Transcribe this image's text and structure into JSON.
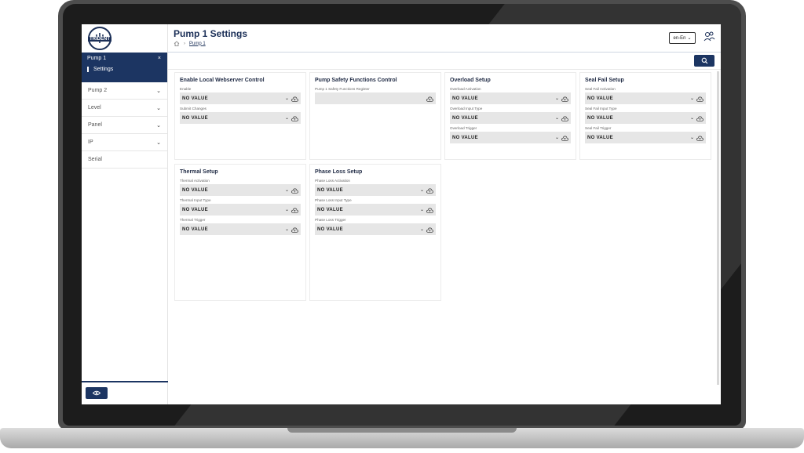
{
  "app": {
    "logo_text": "TRIDENT",
    "page_title": "Pump 1 Settings",
    "breadcrumb": {
      "home_icon": "home-icon",
      "current": "Pump 1"
    },
    "language": "en-En"
  },
  "sidebar": {
    "active": {
      "label": "Pump 1",
      "close": "×",
      "sub_label": "Settings"
    },
    "items": [
      {
        "label": "Pump 2",
        "has_chevron": true
      },
      {
        "label": "Level",
        "has_chevron": true
      },
      {
        "label": "Panel",
        "has_chevron": true
      },
      {
        "label": "IP",
        "has_chevron": true
      },
      {
        "label": "Serial",
        "has_chevron": false
      }
    ]
  },
  "cards": [
    {
      "title": "Enable Local Webserver Control",
      "fields": [
        {
          "label": "Enable",
          "value": "NO VALUE"
        },
        {
          "label": "Submit Changes",
          "value": "NO VALUE"
        }
      ]
    },
    {
      "title": "Pump Safety Functions Control",
      "fields": [
        {
          "label": "Pump 1 Safety Functions Register",
          "value": ""
        }
      ]
    },
    {
      "title": "Overload Setup",
      "fields": [
        {
          "label": "Overload Activation",
          "value": "NO VALUE"
        },
        {
          "label": "Overload Input Type",
          "value": "NO VALUE"
        },
        {
          "label": "Overload Trigger",
          "value": "NO VALUE"
        }
      ]
    },
    {
      "title": "Seal Fail Setup",
      "fields": [
        {
          "label": "Seal Fail Activation",
          "value": "NO VALUE"
        },
        {
          "label": "Seal Fail Input Type",
          "value": "NO VALUE"
        },
        {
          "label": "Seal Fail Trigger",
          "value": "NO VALUE"
        }
      ]
    },
    {
      "title": "Thermal Setup",
      "fields": [
        {
          "label": "Thermal Activation",
          "value": "NO VALUE"
        },
        {
          "label": "Thermal Input Type",
          "value": "NO VALUE"
        },
        {
          "label": "Thermal Trigger",
          "value": "NO VALUE"
        }
      ]
    },
    {
      "title": "Phase Loss Setup",
      "fields": [
        {
          "label": "Phase Loss Activation",
          "value": "NO VALUE"
        },
        {
          "label": "Phase Loss Input Type",
          "value": "NO VALUE"
        },
        {
          "label": "Phase Loss Trigger",
          "value": "NO VALUE"
        }
      ]
    }
  ],
  "colors": {
    "primary": "#1c3562",
    "field_bg": "#e6e6e6"
  }
}
